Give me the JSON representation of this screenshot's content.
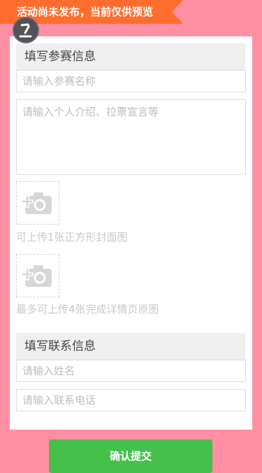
{
  "banner": {
    "text": "活动尚未发布，当前仅供预览",
    "color": "#ff6d2e"
  },
  "avatar": {
    "icon": "avatar-icon"
  },
  "contest_section": {
    "title": "填写参赛信息",
    "name_placeholder": "请输入参赛名称",
    "intro_placeholder": "请输入个人介绍、拉票宣言等"
  },
  "cover_upload": {
    "icon": "add-photo-icon",
    "hint": "可上传1张正方形封面图"
  },
  "detail_upload": {
    "icon": "add-photo-icon",
    "hint": "最多可上传4张完成详情页原图"
  },
  "contact_section": {
    "title": "填写联系信息",
    "name_placeholder": "请输入姓名",
    "phone_placeholder": "请输入联系电话"
  },
  "submit": {
    "label": "确认提交",
    "color": "#45c04a"
  },
  "page": {
    "background_color": "#ff8fa3"
  }
}
